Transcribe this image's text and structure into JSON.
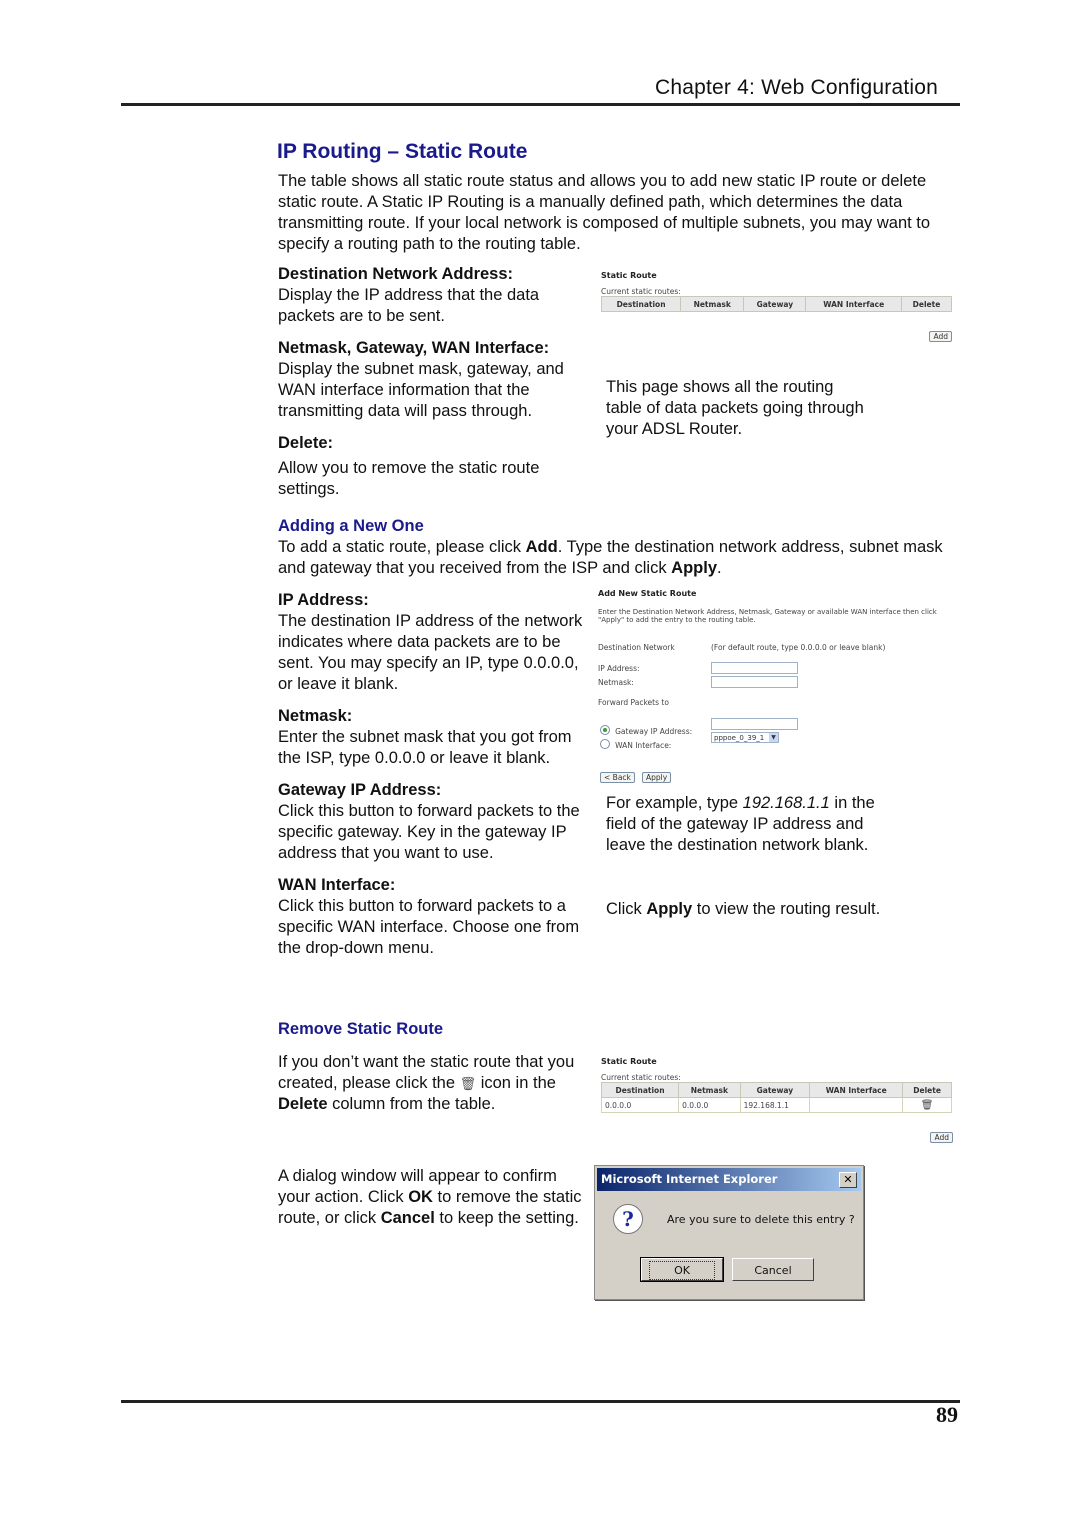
{
  "header": {
    "chapter": "Chapter 4: Web Configuration"
  },
  "title": "IP Routing – Static Route",
  "intro": "The table shows all static route status and allows you to add new static IP route or delete static route. A Static IP Routing is a manually defined path, which determines the data transmitting route. If your local network is composed of multiple subnets, you may want to specify a routing path to the routing table.",
  "fields": [
    {
      "heading": "Destination Network Address:",
      "text": "Display the IP address that the data packets are to be sent."
    },
    {
      "heading": "Netmask, Gateway, WAN Interface:",
      "text": "Display the subnet mask, gateway, and WAN interface information that the transmitting data will pass through."
    },
    {
      "heading": "Delete:",
      "text": "Allow you to remove the static route settings."
    }
  ],
  "routing_note": "This page shows all the routing table of data packets going through your ADSL Router.",
  "static_route_ui": {
    "title": "Static Route",
    "current_label": "Current static routes:",
    "columns": [
      "Destination",
      "Netmask",
      "Gateway",
      "WAN Interface",
      "Delete"
    ],
    "add_button": "Add"
  },
  "adding": {
    "heading": "Adding a New One",
    "text_pre": "To add a static route, please click ",
    "text_add": "Add",
    "text_mid": ". Type the destination network address, subnet mask and gateway that you received from the ISP and click ",
    "text_apply": "Apply",
    "text_end": ".",
    "fields": [
      {
        "heading": "IP Address:",
        "text": "The destination IP address of the network indicates where data packets are to be sent. You may specify an IP, type 0.0.0.0, or leave it blank."
      },
      {
        "heading": "Netmask:",
        "text": "Enter the subnet mask that you got from the ISP, type 0.0.0.0 or leave it blank."
      },
      {
        "heading": "Gateway IP Address:",
        "text": "Click this button to forward packets to the specific gateway. Key in the gateway IP address that you want to use."
      },
      {
        "heading": "WAN Interface:",
        "text": "Click this button to forward packets to a specific WAN interface. Choose one from the drop-down menu."
      }
    ],
    "example_pre": "For example, type ",
    "example_ip": "192.168.1.1",
    "example_post": " in the field of the gateway IP address and leave the destination network blank.",
    "apply_pre": "Click ",
    "apply_bold": "Apply",
    "apply_post": " to view the routing result."
  },
  "add_route_ui": {
    "title": "Add New Static Route",
    "instructions": "Enter the Destination Network Address, Netmask, Gateway or available WAN interface then click \"Apply\" to add the entry to the routing table.",
    "dest_label": "Destination Network",
    "dest_hint": "(For default route, type 0.0.0.0 or leave blank)",
    "ip_label": "IP Address:",
    "ip_value": "",
    "netmask_label": "Netmask:",
    "netmask_value": "",
    "forward_label": "Forward Packets to",
    "gateway_label": "Gateway IP Address:",
    "gateway_value": "",
    "wan_label": "WAN Interface:",
    "wan_selected": "pppoe_0_39_1",
    "back_button": "< Back",
    "apply_button": "Apply"
  },
  "remove": {
    "heading": "Remove Static Route",
    "text_pre": "If you don’t want the static route that you created, please click the ",
    "text_mid": " icon in the ",
    "text_bold": "Delete",
    "text_post": " column from the table.",
    "dialog_pre": "A dialog window will appear to confirm your action. Click ",
    "dialog_ok": "OK",
    "dialog_mid": " to remove the static route, or click ",
    "dialog_cancel": "Cancel",
    "dialog_post": " to keep the setting."
  },
  "static_route_ui_2": {
    "title": "Static Route",
    "current_label": "Current static routes:",
    "columns": [
      "Destination",
      "Netmask",
      "Gateway",
      "WAN Interface",
      "Delete"
    ],
    "rows": [
      {
        "destination": "0.0.0.0",
        "netmask": "0.0.0.0",
        "gateway": "192.168.1.1",
        "wan_interface": "",
        "delete_icon": "trash-icon"
      }
    ],
    "add_button": "Add"
  },
  "dialog": {
    "title": "Microsoft Internet Explorer",
    "message": "Are you sure to delete this entry ?",
    "ok": "OK",
    "cancel": "Cancel",
    "close": "✕"
  },
  "footer": {
    "page_number": "89"
  }
}
